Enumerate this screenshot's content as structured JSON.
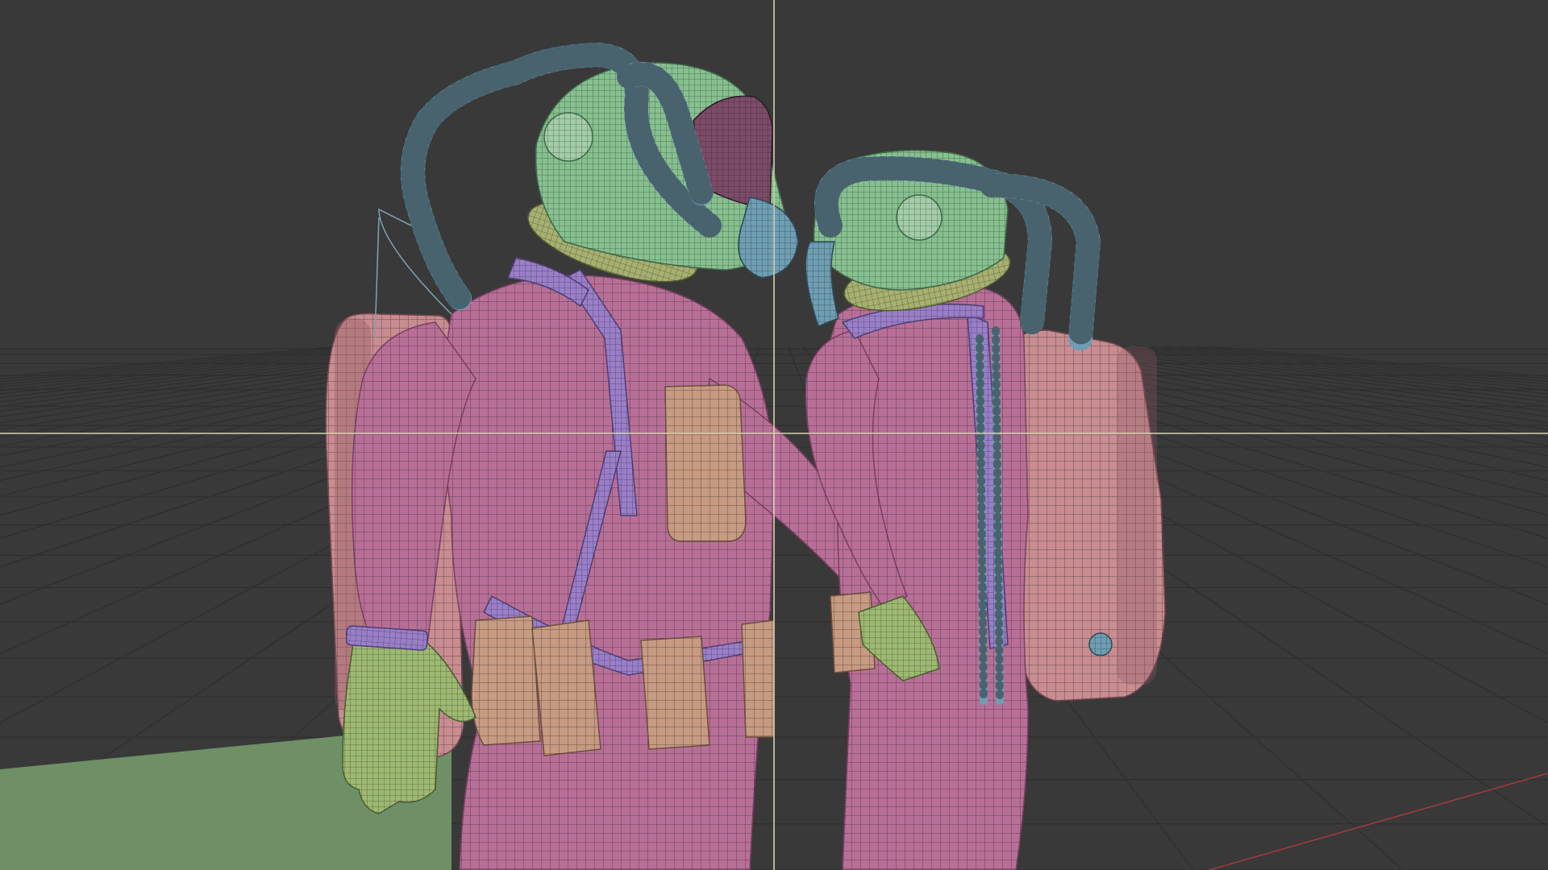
{
  "viewport": {
    "background": "#393939",
    "grid_color": "#2f2f2f",
    "crosshair_color": "#d8d2b0",
    "ground_color": "#6f8f66",
    "x_axis_color": "#a8383c"
  },
  "palette": {
    "suit": "#b86f97",
    "suit_dark": "#7c3f63",
    "helmet": "#86c08f",
    "hose": "#6e9eb3",
    "harness": "#9a7ec9",
    "pouch": "#c79a82",
    "backpack": "#c88c91",
    "glove": "#9db971",
    "wire": "#1d1d1d"
  },
  "scene": {
    "objects": [
      {
        "name": "diver-left",
        "icon": "diver-model"
      },
      {
        "name": "diver-right",
        "icon": "diver-model"
      }
    ]
  }
}
